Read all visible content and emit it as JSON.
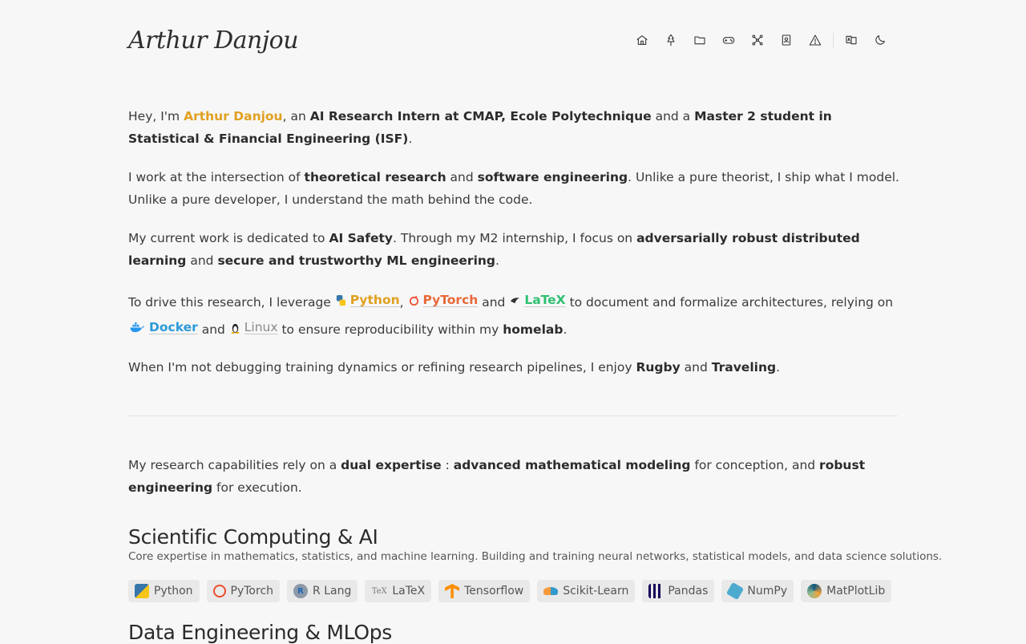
{
  "header": {
    "logo": "Arthur Danjou",
    "nav": [
      "home-icon",
      "tree-icon",
      "folder-icon",
      "gamepad-icon",
      "network-icon",
      "contact-book-icon",
      "warning-icon",
      "translate-icon",
      "moon-icon"
    ]
  },
  "intro": {
    "p1": {
      "a": "Hey, I'm ",
      "name": "Arthur Danjou",
      "b": ", an ",
      "role": "AI Research Intern at CMAP, Ecole Polytechnique",
      "c": " and a ",
      "study": "Master 2 student in Statistical & Financial Engineering (ISF)",
      "d": "."
    },
    "p2": {
      "a": "I work at the intersection of ",
      "t1": "theoretical research",
      "b": " and ",
      "t2": "software engineering",
      "c": ". Unlike a pure theorist, I ship what I model. Unlike a pure developer, I understand the math behind the code."
    },
    "p3": {
      "a": "My current work is dedicated to ",
      "t1": "AI Safety",
      "b": ". Through my M2 internship, I focus on ",
      "t2": "adversarially robust distributed learning",
      "c": " and ",
      "t3": "secure and trustworthy ML engineering",
      "d": "."
    },
    "p4": {
      "a": "To drive this research, I leverage ",
      "python": "Python",
      "comma": ",",
      "pytorch": "PyTorch",
      "and1": " and ",
      "latex": "LaTeX",
      "b": " to document and formalize architectures, relying on ",
      "docker": "Docker",
      "and2": " and ",
      "linux": "Linux",
      "c": " to ensure reproducibility within my ",
      "homelab": "homelab",
      "d": "."
    },
    "p5": {
      "a": "When I'm not debugging training dynamics or refining research pipelines, I enjoy ",
      "t1": "Rugby",
      "b": " and ",
      "t2": "Traveling",
      "c": "."
    }
  },
  "expertise": {
    "a": "My research capabilities rely on a ",
    "t1": "dual expertise",
    "b": " : ",
    "t2": "advanced mathematical modeling",
    "c": " for conception, and ",
    "t3": "robust engineering",
    "d": " for execution."
  },
  "section1": {
    "title": "Scientific Computing & AI",
    "desc": "Core expertise in mathematics, statistics, and machine learning. Building and training neural networks, statistical models, and data science solutions.",
    "tags": [
      "Python",
      "PyTorch",
      "R Lang",
      "LaTeX",
      "Tensorflow",
      "Scikit-Learn",
      "Pandas",
      "NumPy",
      "MatPlotLib"
    ]
  },
  "section2": {
    "title": "Data Engineering & MLOps"
  }
}
